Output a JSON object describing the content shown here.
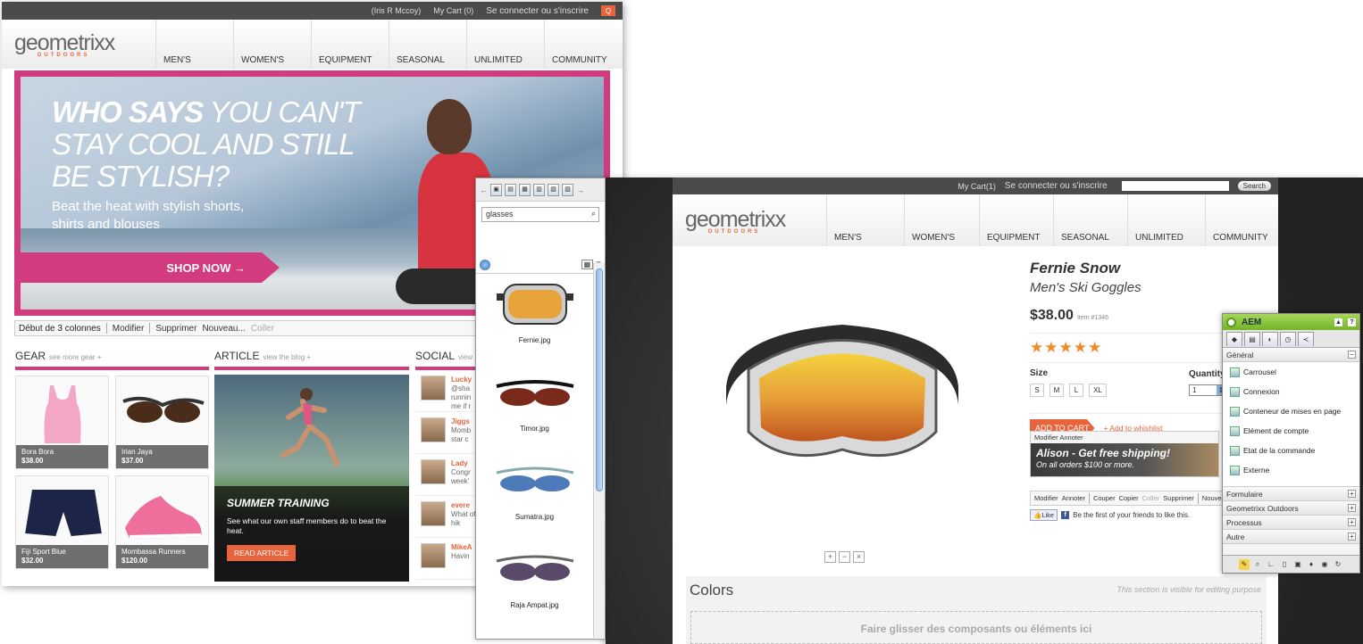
{
  "left_site": {
    "topbar": {
      "user": "(Iris R Mccoy)",
      "cart": "My Cart (0)",
      "signin": "Se connecter ou s'inscrire",
      "search_glyph": "Q"
    },
    "logo": {
      "name": "geometrixx",
      "sub": "OUTDOORS"
    },
    "nav": [
      "MEN'S",
      "WOMEN'S",
      "EQUIPMENT",
      "SEASONAL",
      "UNLIMITED",
      "COMMUNITY"
    ],
    "hero": {
      "line1_bold": "WHO SAYS",
      "line1_rest": " YOU CAN'T",
      "line2": "STAY COOL AND STILL",
      "line3": "BE STYLISH?",
      "sub": "Beat the heat with stylish shorts, shirts and blouses",
      "cta": "SHOP NOW →"
    },
    "edit_bar": {
      "label": "Début de 3 colonnes",
      "modify": "Modifier",
      "delete": "Supprimer",
      "new": "Nouveau...",
      "paste": "Coller"
    },
    "gear": {
      "title": "GEAR",
      "link": "see more gear +",
      "products": [
        {
          "name": "Bora Bora",
          "price": "$38.00"
        },
        {
          "name": "Irian Jaya",
          "price": "$37.00"
        },
        {
          "name": "Fiji Sport Blue",
          "price": "$32.00"
        },
        {
          "name": "Mombassa Runners",
          "price": "$120.00"
        }
      ]
    },
    "article": {
      "title": "ARTICLE",
      "link": "view the blog +",
      "heading": "SUMMER TRAINING",
      "text": "See what our own staff members do to beat the heat.",
      "button": "READ ARTICLE"
    },
    "social": {
      "title": "SOCIAL",
      "link": "view",
      "posts": [
        {
          "name": "Lucky",
          "text": "@sha runnin me if r"
        },
        {
          "name": "Jiggs",
          "text": "Momb star c"
        },
        {
          "name": "Lady",
          "text": "Congr week'"
        },
        {
          "name": "evere",
          "text": "What of hik"
        },
        {
          "name": "MikeA",
          "text": "Havin"
        }
      ]
    }
  },
  "finder": {
    "search_value": "glasses",
    "items": [
      "Fernie.jpg",
      "Timor.jpg",
      "Sumatra.jpg",
      "Raja Ampat.jpg"
    ]
  },
  "right_site": {
    "topbar": {
      "cart": "My Cart(1)",
      "signin": "Se connecter ou s'inscrire",
      "search_btn": "Search"
    },
    "logo": {
      "name": "geometrixx",
      "sub": "OUTDOORS"
    },
    "nav": [
      "MEN'S",
      "WOMEN'S",
      "EQUIPMENT",
      "SEASONAL",
      "UNLIMITED",
      "COMMUNITY"
    ],
    "product": {
      "name": "Fernie Snow",
      "subtitle": "Men's Ski Goggles",
      "price": "$38.00",
      "item": "Item #1346",
      "stars": "★★★★★",
      "size_label": "Size",
      "sizes": [
        "S",
        "M",
        "L",
        "XL"
      ],
      "qty_label": "Quantity",
      "qty_value": "1",
      "add_to_cart": "ADD TO CART",
      "wishlist": "+ Add to whishlist"
    },
    "shipping": {
      "edit": "Modifier Annoter",
      "title": "Alison - Get free shipping!",
      "sub": "On all orders $100 or more."
    },
    "edit_bar": {
      "modify": "Modifier",
      "annotate": "Annoter",
      "cut": "Couper",
      "copy": "Copier",
      "paste": "Coller",
      "delete": "Supprimer",
      "new": "Nouvea"
    },
    "like": {
      "button": "Like",
      "text": "Be the first of your friends to like this."
    },
    "zoom": [
      "+",
      "−",
      "×"
    ],
    "colors": {
      "title": "Colors",
      "note": "This section is visible for editing purpose",
      "drop": "Faire glisser des composants ou éléments ici"
    }
  },
  "sidekick": {
    "title": "AEM",
    "groups_open": "Général",
    "items": [
      "Carrousel",
      "Connexion",
      "Conteneur de mises en page",
      "Elément de compte",
      "Etat de la commande",
      "Externe"
    ],
    "groups": [
      "Formulaire",
      "Geometrixx Outdoors",
      "Processus",
      "Autre"
    ]
  },
  "colors": {
    "accent_pink": "#d23b7d",
    "accent_orange": "#e8643c",
    "sidekick_green": "#8cc63f"
  }
}
